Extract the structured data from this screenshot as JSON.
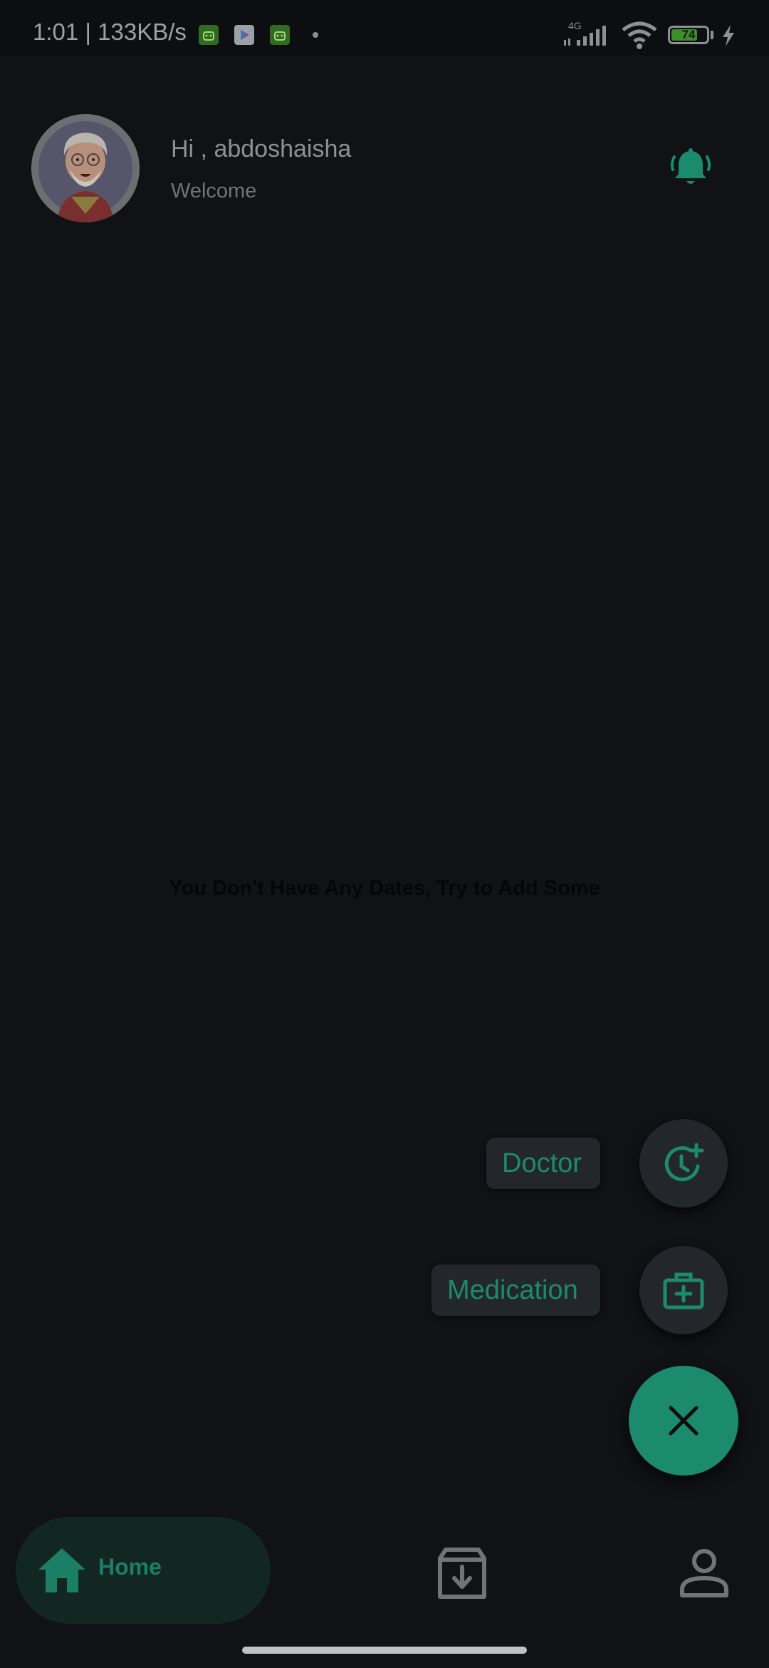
{
  "status_bar": {
    "time_speed": "1:01 | 133KB/s",
    "network": "4G",
    "battery_level": "74",
    "icons": [
      "android-app-icon",
      "play-store-icon",
      "android-app-icon",
      "notification-dot",
      "signal-icon",
      "wifi-icon",
      "battery-icon",
      "charging-icon"
    ]
  },
  "header": {
    "greeting": "Hi , abdoshaisha",
    "subtitle": "Welcome",
    "avatar": "avatar",
    "bell_icon": "bell-ringing-icon"
  },
  "main": {
    "empty_message": "You Don't Have Any Dates, Try to Add Some"
  },
  "speed_dial": {
    "doctor_label": "Doctor",
    "doctor_icon": "clock-plus-icon",
    "medication_label": "Medication",
    "medication_icon": "medical-kit-icon",
    "close_icon": "close-icon"
  },
  "bottom_nav": {
    "home_label": "Home",
    "items": [
      "home-icon",
      "archive-icon",
      "profile-icon"
    ]
  },
  "colors": {
    "accent": "#1c8a6c",
    "background": "#101216",
    "nav_active_bg": "#122622"
  }
}
